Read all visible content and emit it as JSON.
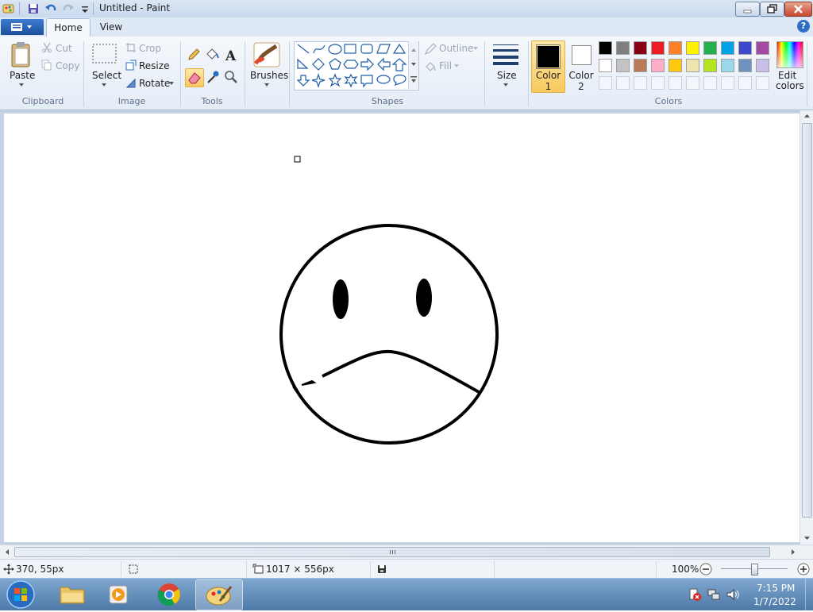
{
  "window": {
    "title": "Untitled - Paint"
  },
  "tabs": [
    {
      "label": "Home",
      "active": true
    },
    {
      "label": "View",
      "active": false
    }
  ],
  "ribbon": {
    "clipboard": {
      "group": "Clipboard",
      "paste": "Paste",
      "cut": "Cut",
      "copy": "Copy"
    },
    "image": {
      "group": "Image",
      "select": "Select",
      "crop": "Crop",
      "resize": "Resize",
      "rotate": "Rotate"
    },
    "tools": {
      "group": "Tools"
    },
    "brushes": {
      "label": "Brushes"
    },
    "shapes": {
      "group": "Shapes",
      "outline": "Outline",
      "fill": "Fill"
    },
    "size": {
      "label": "Size"
    },
    "color1": {
      "line1": "Color",
      "line2": "1",
      "value": "#000000"
    },
    "color2": {
      "line1": "Color",
      "line2": "2",
      "value": "#ffffff"
    },
    "colors": {
      "group": "Colors",
      "edit_line1": "Edit",
      "edit_line2": "colors",
      "palette_row1": [
        "#000000",
        "#7f7f7f",
        "#880015",
        "#ed1c24",
        "#ff7f27",
        "#fff200",
        "#22b14c",
        "#00a2e8",
        "#3f48cc",
        "#a349a4"
      ],
      "palette_row2": [
        "#ffffff",
        "#c3c3c3",
        "#b97a57",
        "#ffaec9",
        "#ffc90e",
        "#efe4b0",
        "#b5e61d",
        "#99d9ea",
        "#7092be",
        "#c8bfe7"
      ]
    }
  },
  "status": {
    "cursor_pos": "370, 55px",
    "canvas_size": "1017 × 556px",
    "zoom": "100%"
  },
  "taskbar": {
    "time": "7:15 PM",
    "date": "1/7/2022"
  }
}
